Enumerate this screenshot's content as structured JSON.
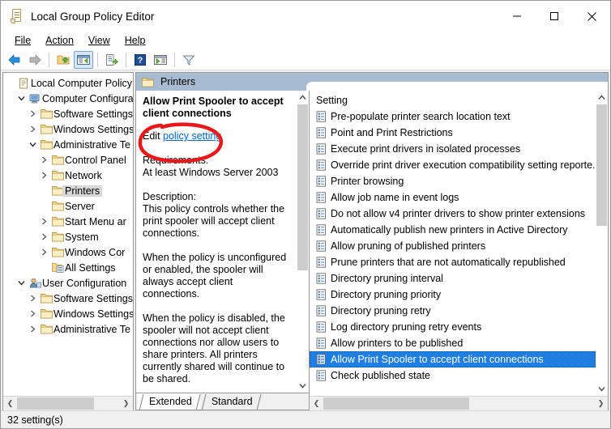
{
  "window": {
    "title": "Local Group Policy Editor",
    "icon": "policy-document-icon",
    "minimize_label": "Minimize",
    "maximize_label": "Maximize",
    "close_label": "Close"
  },
  "menu": {
    "items": [
      {
        "label": "File",
        "accel": "F"
      },
      {
        "label": "Action",
        "accel": "A"
      },
      {
        "label": "View",
        "accel": "V"
      },
      {
        "label": "Help",
        "accel": "H"
      }
    ]
  },
  "toolbar": {
    "buttons": [
      {
        "name": "back-button",
        "icon": "left-arrow-icon",
        "label": "Back"
      },
      {
        "name": "forward-button",
        "icon": "right-arrow-icon",
        "label": "Forward"
      },
      {
        "name": "up-one-level-button",
        "icon": "folder-up-icon",
        "label": "Up One Level"
      },
      {
        "name": "show-hide-console-tree-button",
        "icon": "console-tree-icon",
        "label": "Show/Hide Console Tree"
      },
      {
        "name": "export-list-button",
        "icon": "export-list-icon",
        "label": "Export List"
      },
      {
        "name": "help-button",
        "icon": "question-mark-icon",
        "label": "Help"
      },
      {
        "name": "show-hide-action-pane-button",
        "icon": "action-pane-icon",
        "label": "Show/Hide Action Pane"
      },
      {
        "name": "filter-button",
        "icon": "funnel-icon",
        "label": "Filter"
      }
    ]
  },
  "tree": {
    "nodes": [
      {
        "label": "Local Computer Policy",
        "indent": 0,
        "twisty": "none",
        "icon": "policy-document-icon",
        "selected": false
      },
      {
        "label": "Computer Configura",
        "indent": 1,
        "twisty": "expanded",
        "icon": "computer-icon",
        "selected": false
      },
      {
        "label": "Software Settings",
        "indent": 2,
        "twisty": "collapsed",
        "icon": "folder-icon",
        "selected": false
      },
      {
        "label": "Windows Settings",
        "indent": 2,
        "twisty": "collapsed",
        "icon": "folder-icon",
        "selected": false
      },
      {
        "label": "Administrative Te",
        "indent": 2,
        "twisty": "expanded",
        "icon": "folder-icon",
        "selected": false
      },
      {
        "label": "Control Panel",
        "indent": 3,
        "twisty": "collapsed",
        "icon": "folder-icon",
        "selected": false
      },
      {
        "label": "Network",
        "indent": 3,
        "twisty": "collapsed",
        "icon": "folder-icon",
        "selected": false
      },
      {
        "label": "Printers",
        "indent": 3,
        "twisty": "none",
        "icon": "folder-icon",
        "selected": true
      },
      {
        "label": "Server",
        "indent": 3,
        "twisty": "none",
        "icon": "folder-icon",
        "selected": false
      },
      {
        "label": "Start Menu ar",
        "indent": 3,
        "twisty": "collapsed",
        "icon": "folder-icon",
        "selected": false
      },
      {
        "label": "System",
        "indent": 3,
        "twisty": "collapsed",
        "icon": "folder-icon",
        "selected": false
      },
      {
        "label": "Windows Cor",
        "indent": 3,
        "twisty": "collapsed",
        "icon": "folder-icon",
        "selected": false
      },
      {
        "label": "All Settings",
        "indent": 3,
        "twisty": "none",
        "icon": "all-settings-icon",
        "selected": false
      },
      {
        "label": "User Configuration",
        "indent": 1,
        "twisty": "expanded",
        "icon": "user-icon",
        "selected": false
      },
      {
        "label": "Software Settings",
        "indent": 2,
        "twisty": "collapsed",
        "icon": "folder-icon",
        "selected": false
      },
      {
        "label": "Windows Settings",
        "indent": 2,
        "twisty": "collapsed",
        "icon": "folder-icon",
        "selected": false
      },
      {
        "label": "Administrative Te",
        "indent": 2,
        "twisty": "collapsed",
        "icon": "folder-icon",
        "selected": false
      }
    ]
  },
  "pane_header": {
    "title": "Printers",
    "icon": "folder-icon"
  },
  "description": {
    "title": "Allow Print Spooler to accept client connections",
    "edit_prefix": "Edit ",
    "edit_link": "policy setting",
    "requirements_label": "Requirements:",
    "requirements_value": "At least Windows Server 2003",
    "description_label": "Description:",
    "paragraphs": [
      "This policy controls whether the print spooler will accept client connections.",
      "When the policy is unconfigured or enabled, the spooler will always accept client connections.",
      "When the policy is disabled, the spooler will not accept client connections nor allow users to share printers.  All printers currently shared will continue to be shared."
    ]
  },
  "tabs": [
    {
      "label": "Extended",
      "active": true
    },
    {
      "label": "Standard",
      "active": false
    }
  ],
  "settings_list": {
    "column_header": "Setting",
    "rows": [
      {
        "label": "Pre-populate printer search location text",
        "selected": false
      },
      {
        "label": "Point and Print Restrictions",
        "selected": false
      },
      {
        "label": "Execute print drivers in isolated processes",
        "selected": false
      },
      {
        "label": "Override print driver execution compatibility setting reporte...",
        "selected": false
      },
      {
        "label": "Printer browsing",
        "selected": false
      },
      {
        "label": "Allow job name in event logs",
        "selected": false
      },
      {
        "label": "Do not allow v4 printer drivers to show printer extensions",
        "selected": false
      },
      {
        "label": "Automatically publish new printers in Active Directory",
        "selected": false
      },
      {
        "label": "Allow pruning of published printers",
        "selected": false
      },
      {
        "label": "Prune printers that are not automatically republished",
        "selected": false
      },
      {
        "label": "Directory pruning interval",
        "selected": false
      },
      {
        "label": "Directory pruning priority",
        "selected": false
      },
      {
        "label": "Directory pruning retry",
        "selected": false
      },
      {
        "label": "Log directory pruning retry events",
        "selected": false
      },
      {
        "label": "Allow printers to be published",
        "selected": false
      },
      {
        "label": "Allow Print Spooler to accept client connections",
        "selected": true
      },
      {
        "label": "Check published state",
        "selected": false
      }
    ]
  },
  "status": {
    "text": "32 setting(s)"
  },
  "annotation": {
    "type": "hand-drawn-ellipse",
    "color": "#e8191b",
    "target": "Edit policy setting link"
  },
  "colors": {
    "header_bar": "#a7bbd3",
    "selection": "#1f7fe0",
    "link": "#0066cc",
    "annotation_red": "#e8191b",
    "window_chrome": "#f0f0f0"
  }
}
